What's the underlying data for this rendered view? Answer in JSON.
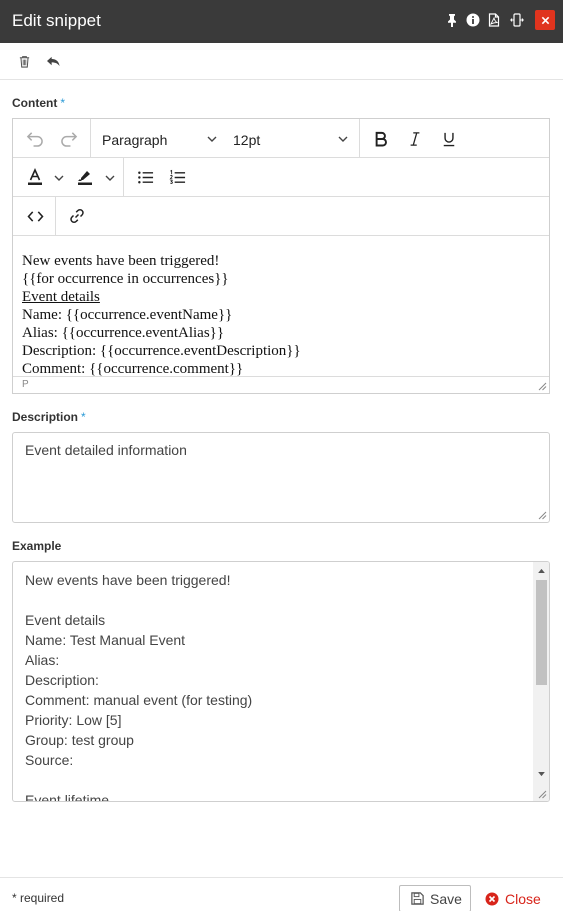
{
  "window": {
    "title": "Edit snippet",
    "icons": [
      "pin-icon",
      "info-icon",
      "pdf-icon",
      "resize-width-icon",
      "close-icon"
    ]
  },
  "actions": {
    "icons": [
      "trash-icon",
      "undo-arrow-icon"
    ]
  },
  "content": {
    "label": "Content",
    "required_mark": "*",
    "toolbar": {
      "block_format": "Paragraph",
      "font_size": "12pt"
    },
    "lines": [
      "New events have been triggered!",
      "{{for occurrence in occurrences}}",
      "Event details",
      "Name: {{occurrence.eventName}}",
      "Alias: {{occurrence.eventAlias}}",
      "Description: {{occurrence.eventDescription}}",
      "Comment: {{occurrence.comment}}"
    ],
    "status_path": "P"
  },
  "description": {
    "label": "Description",
    "required_mark": "*",
    "value": "Event detailed information"
  },
  "example": {
    "label": "Example",
    "lines": [
      "New events have been triggered!",
      "",
      "Event details",
      "Name: Test Manual Event",
      "Alias:",
      "Description:",
      "Comment: manual event (for testing)",
      "Priority: Low [5]",
      "Group: test group",
      "Source:",
      "",
      "Event lifetime"
    ]
  },
  "footer": {
    "required_note": "* required",
    "save_label": "Save",
    "close_label": "Close"
  },
  "colors": {
    "titlebar": "#3a3a3a",
    "close_button": "#e0341e",
    "required_asterisk": "#2a9ad6",
    "close_text": "#d8241a"
  }
}
